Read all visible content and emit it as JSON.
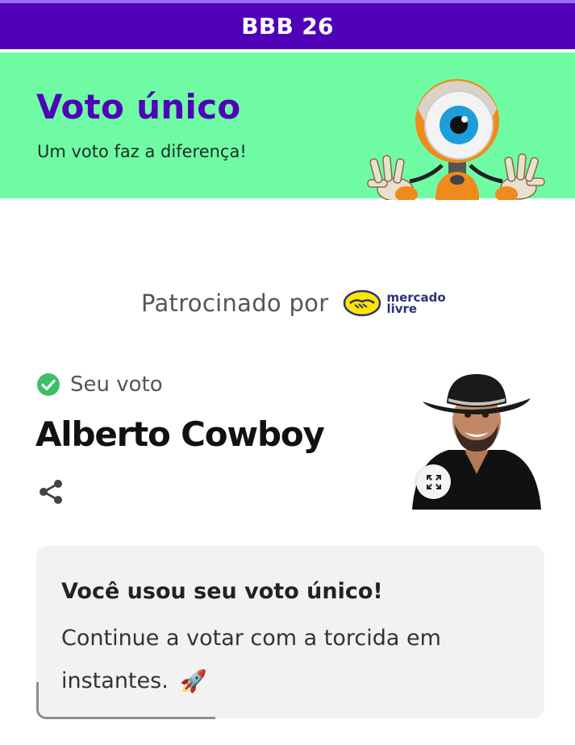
{
  "header": {
    "title": "BBB 26"
  },
  "hero": {
    "title": "Voto único",
    "subtitle": "Um voto faz a diferença!",
    "background": "#6ffba4",
    "title_color": "#4f02b8",
    "mascot_icon": "big-brother-eye-mascot"
  },
  "sponsor": {
    "label": "Patrocinado por",
    "logo_line1": "mercado",
    "logo_line2": "livre",
    "logo_icon": "handshake-icon"
  },
  "vote": {
    "label": "Seu voto",
    "status_icon": "check-circle-icon",
    "candidate_name": "Alberto Cowboy",
    "share_icon": "share-icon",
    "expand_icon": "expand-icon"
  },
  "info": {
    "title": "Você usou seu voto único!",
    "body": "Continue a votar com a torcida em instantes.",
    "emoji": "🚀"
  },
  "colors": {
    "brand_purple": "#4f02b8",
    "accent_green": "#6ffba4",
    "check_green": "#3cbf6a"
  }
}
